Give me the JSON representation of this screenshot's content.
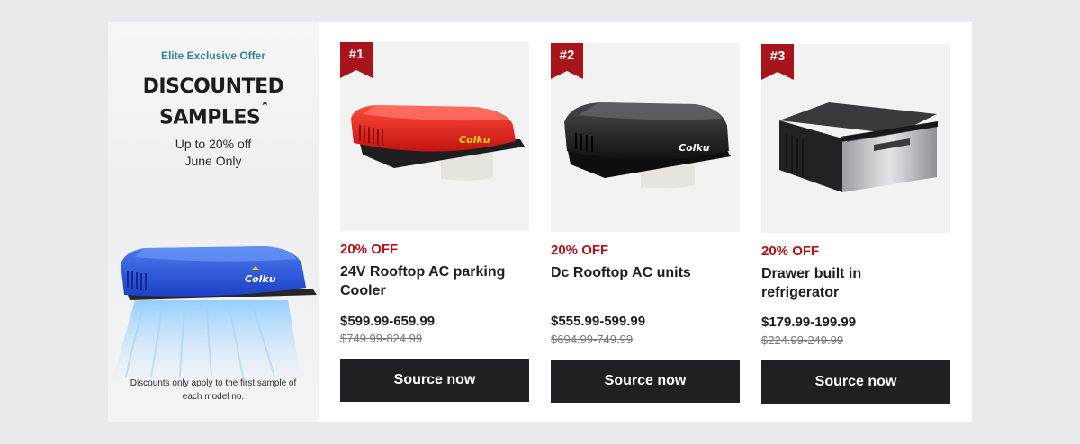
{
  "promo": {
    "eyebrow": "Elite Exclusive Offer",
    "headline_line1": "DISCOUNTED",
    "headline_line2": "SAMPLES",
    "asterisk": "*",
    "sub_line1": "Up to 20% off",
    "sub_line2": "June Only",
    "note": "Discounts only apply to the first sample of each model no.",
    "image_brand": "Colku"
  },
  "products": [
    {
      "rank": "#1",
      "discount": "20% OFF",
      "name": "24V Rooftop AC parking Cooler",
      "price": "$599.99-659.99",
      "original_price": "$749.99-824.99",
      "button": "Source now",
      "brand": "Colku",
      "color": "#e3261f"
    },
    {
      "rank": "#2",
      "discount": "20% OFF",
      "name": "Dc Rooftop AC units",
      "price": "$555.99-599.99",
      "original_price": "$694.99-749.99",
      "button": "Source now",
      "brand": "Colku",
      "color": "#1b1b1d"
    },
    {
      "rank": "#3",
      "discount": "20% OFF",
      "name": "Drawer built in refrigerator",
      "price": "$179.99-199.99",
      "original_price": "$224.99-249.99",
      "button": "Source now",
      "color": "#2a2a2c"
    }
  ],
  "colors": {
    "accent_red": "#b3131b",
    "rank_badge": "#a8141b",
    "eyebrow_teal": "#2f8595",
    "button_dark": "#1f2024",
    "page_bg": "#e8eaee"
  }
}
